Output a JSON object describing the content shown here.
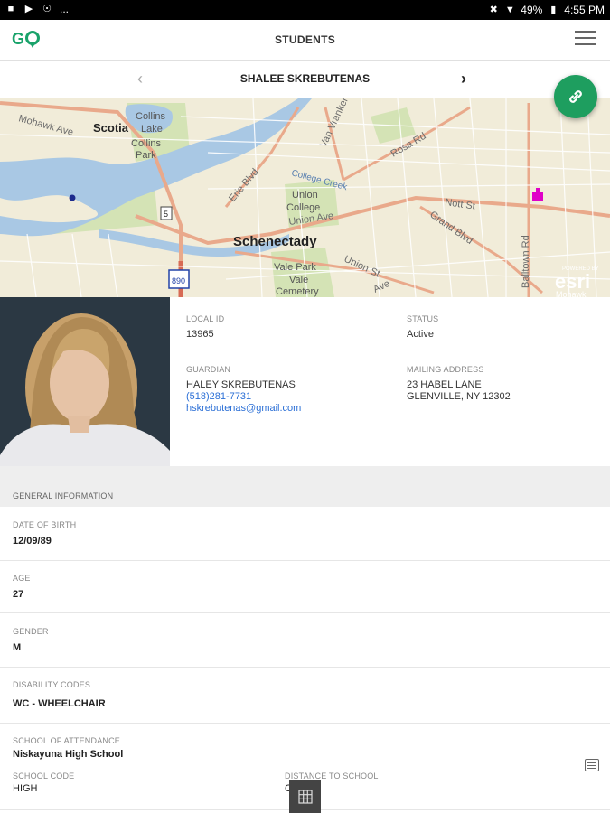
{
  "status_bar": {
    "left_icons": [
      "notification-icon",
      "play-store-icon",
      "sync-icon",
      "more-icon"
    ],
    "more_text": "...",
    "battery": "49%",
    "time": "4:55 PM"
  },
  "app_bar": {
    "logo": "GO",
    "title": "STUDENTS"
  },
  "student_nav": {
    "prev": "‹",
    "next": "›",
    "name": "SHALEE SKREBUTENAS"
  },
  "map": {
    "labels": {
      "mohawk": "Mohawk Ave",
      "scotia": "Scotia",
      "collins_lake": "Collins\nLake",
      "collins_park": "Collins\nPark",
      "van_vranken": "Van Vranken",
      "rosa": "Rosa Rd",
      "erie": "Erie Blvd",
      "college_creek": "College Creek",
      "union_college": "Union\nCollege",
      "union_ave": "Union Ave",
      "nott": "Nott St",
      "grand": "Grand Blvd",
      "balltown": "Balltown Rd",
      "schenectady": "Schenectady",
      "union_st": "Union St",
      "vale_park": "Vale Park",
      "vale_cemetery": "Vale\nCemetery",
      "route5": "5",
      "route890": "890",
      "esri_powered": "POWERED BY",
      "esri": "esri",
      "mohawk_small": "Mohawk",
      "state_ave": "Ave"
    },
    "colors": {
      "land": "#f1ecd9",
      "water": "#a9c8e4",
      "park": "#d4e3b5",
      "road_major": "#e9a98b",
      "road_minor": "#ffffff",
      "school_marker": "#e000c8",
      "home_marker": "#1c2a8c"
    }
  },
  "fab": {
    "icon": "link-icon"
  },
  "student_info": {
    "local_id_label": "LOCAL ID",
    "local_id": "13965",
    "status_label": "STATUS",
    "status": "Active",
    "guardian_label": "GUARDIAN",
    "guardian_name": "HALEY SKREBUTENAS",
    "guardian_phone": "(518)281-7731",
    "guardian_email": "hskrebutenas@gmail.com",
    "mailing_label": "MAILING ADDRESS",
    "mailing_line1": "23 HABEL LANE",
    "mailing_line2": "GLENVILLE, NY 12302"
  },
  "general": {
    "header": "GENERAL INFORMATION",
    "fields": [
      {
        "label": "DATE OF BIRTH",
        "value": "12/09/89"
      },
      {
        "label": "AGE",
        "value": "27"
      },
      {
        "label": "GENDER",
        "value": "M"
      },
      {
        "label": "DISABILITY CODES",
        "value": "WC - WHEELCHAIR"
      },
      {
        "label": "SCHOOL OF ATTENDANCE",
        "value": "Niskayuna High School"
      }
    ],
    "school_code_label": "SCHOOL CODE",
    "school_code": "HIGH",
    "distance_label": "DISTANCE TO SCHOOL",
    "distance_value": "C"
  }
}
